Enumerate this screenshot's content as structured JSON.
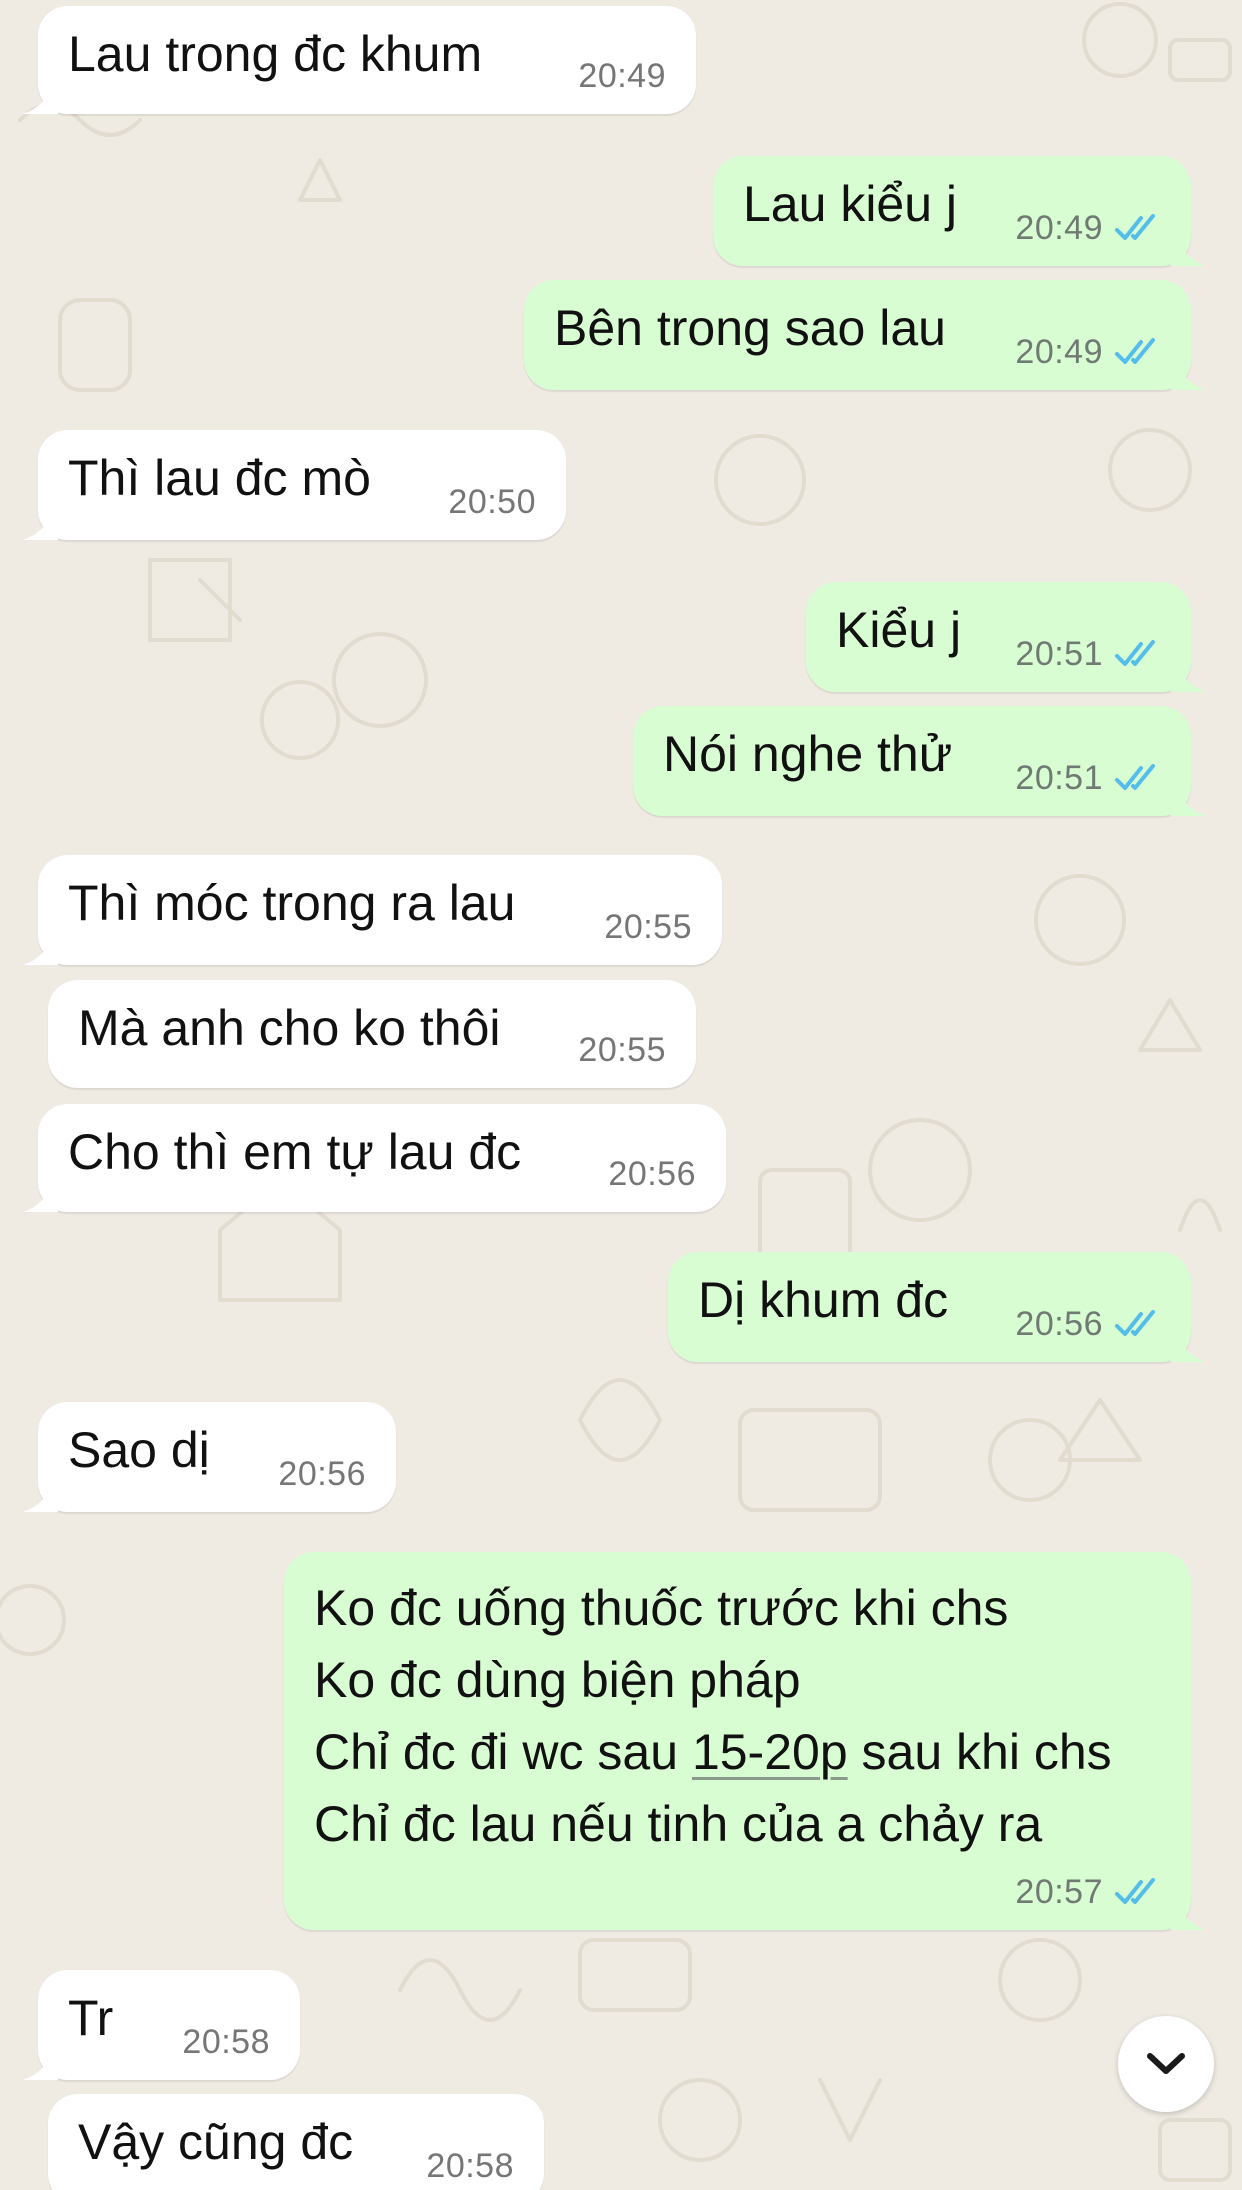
{
  "messages": [
    {
      "direction": "in",
      "text": "Lau trong đc khum",
      "time": "20:49"
    },
    {
      "direction": "out",
      "text": "Lau kiểu j",
      "time": "20:49",
      "status": "read"
    },
    {
      "direction": "out",
      "text": "Bên trong sao lau",
      "time": "20:49",
      "status": "read"
    },
    {
      "direction": "in",
      "text": "Thì lau đc mò",
      "time": "20:50"
    },
    {
      "direction": "out",
      "text": "Kiểu j",
      "time": "20:51",
      "status": "read"
    },
    {
      "direction": "out",
      "text": "Nói nghe thử",
      "time": "20:51",
      "status": "read"
    },
    {
      "direction": "in",
      "text": "Thì móc trong ra lau",
      "time": "20:55"
    },
    {
      "direction": "in",
      "text": "Mà anh cho ko thôi",
      "time": "20:55"
    },
    {
      "direction": "in",
      "text": "Cho thì em tự lau đc",
      "time": "20:56"
    },
    {
      "direction": "out",
      "text": "Dị khum đc",
      "time": "20:56",
      "status": "read"
    },
    {
      "direction": "in",
      "text": "Sao dị",
      "time": "20:56"
    },
    {
      "direction": "out",
      "lines": {
        "l1": "Ko đc uống thuốc trước khi chs",
        "l2": "Ko đc dùng biện pháp",
        "l3_pre": "Chỉ đc đi wc sau ",
        "l3_link": "15-20p",
        "l3_post": " sau khi chs",
        "l4": "Chỉ đc lau nếu tinh của a chảy ra"
      },
      "time": "20:57",
      "status": "read"
    },
    {
      "direction": "in",
      "text": "Tr",
      "time": "20:58"
    },
    {
      "direction": "in",
      "text": "Vậy cũng đc",
      "time": "20:58"
    }
  ],
  "icons": {
    "read_receipt": "double-check-icon",
    "scroll_down": "chevron-down-icon"
  },
  "colors": {
    "background": "#efeae2",
    "incoming_bubble": "#ffffff",
    "outgoing_bubble": "#d9fdd3",
    "read_check": "#53bdeb"
  }
}
